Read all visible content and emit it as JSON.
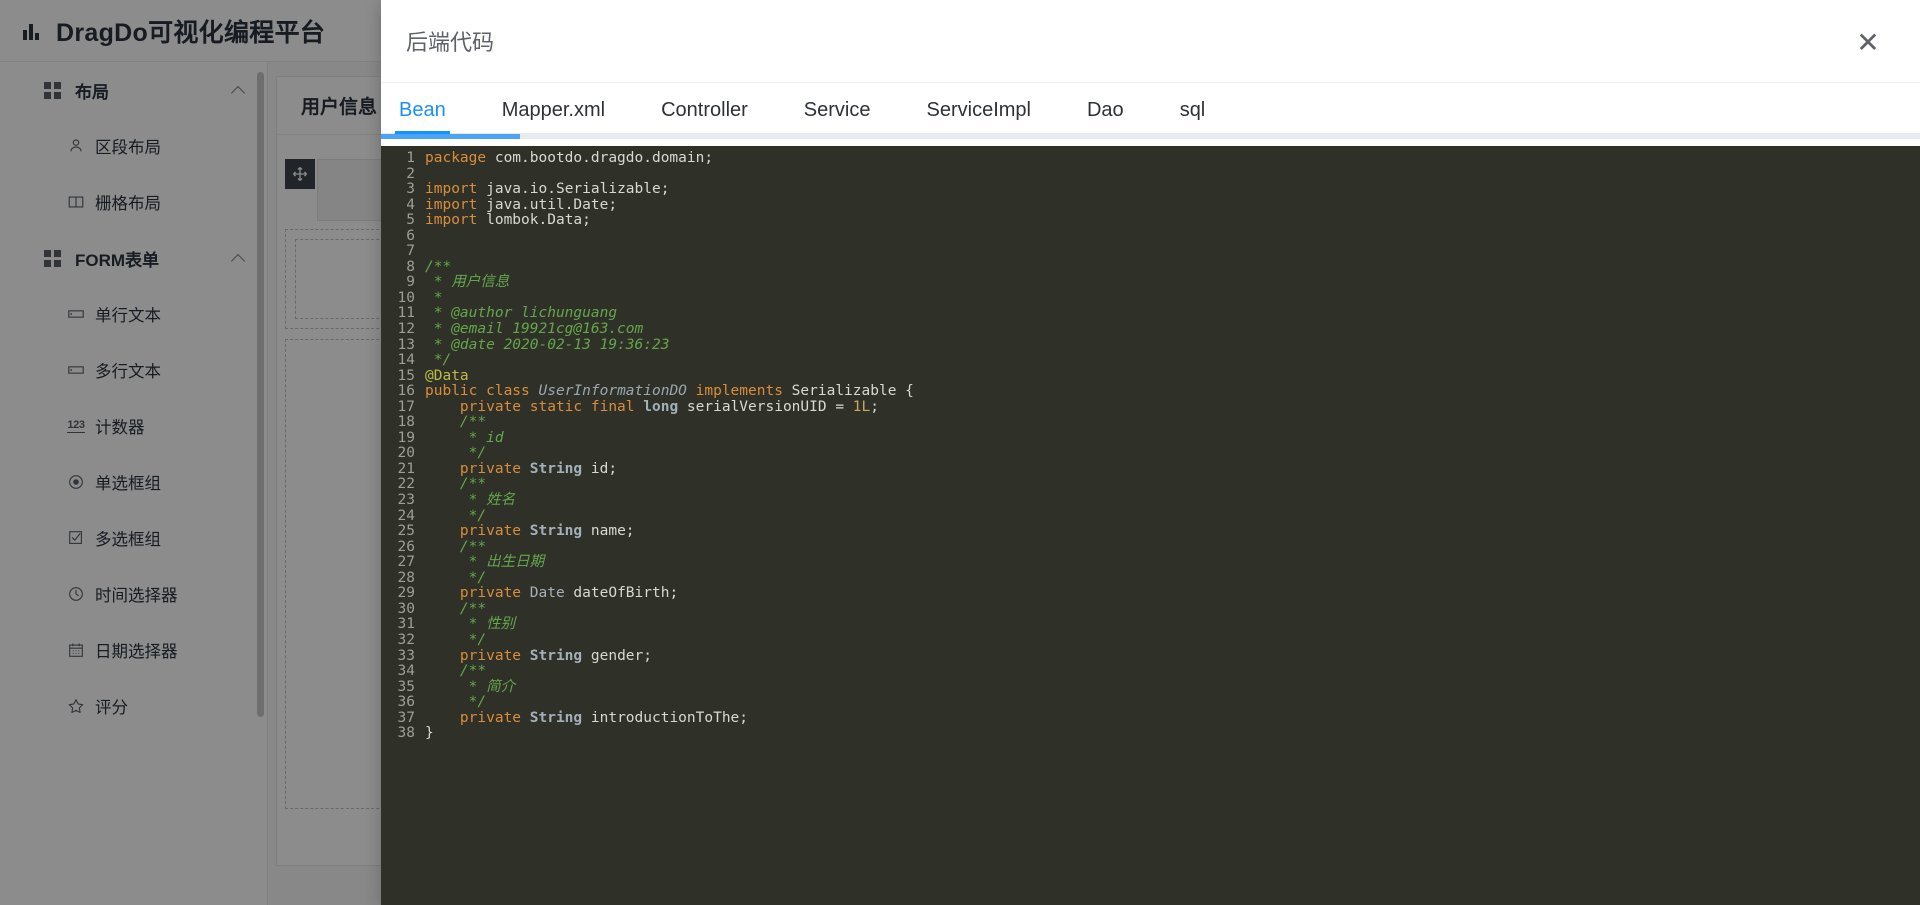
{
  "app": {
    "title": "DragDo可视化编程平台",
    "logo_icon": "bar-chart-icon"
  },
  "sidebar": {
    "groups": [
      {
        "label": "布局",
        "icon": "grid-icon",
        "chevron": "chevron-up-icon",
        "items": [
          {
            "label": "区段布局",
            "icon": "user-icon"
          },
          {
            "label": "栅格布局",
            "icon": "columns-icon"
          }
        ]
      },
      {
        "label": "FORM表单",
        "icon": "grid-icon",
        "chevron": "chevron-up-icon",
        "items": [
          {
            "label": "单行文本",
            "icon": "input-box-icon"
          },
          {
            "label": "多行文本",
            "icon": "textarea-icon"
          },
          {
            "label": "计数器",
            "icon": "number-123-icon"
          },
          {
            "label": "单选框组",
            "icon": "radio-icon"
          },
          {
            "label": "多选框组",
            "icon": "checkbox-icon"
          },
          {
            "label": "时间选择器",
            "icon": "clock-icon"
          },
          {
            "label": "日期选择器",
            "icon": "calendar-icon"
          },
          {
            "label": "评分",
            "icon": "star-icon"
          }
        ]
      }
    ]
  },
  "workspace": {
    "card_title": "用户信息",
    "move_icon": "move-arrows-icon"
  },
  "modal": {
    "title": "后端代码",
    "close_icon": "close-icon",
    "progress_percent": 9,
    "tabs": [
      {
        "label": "Bean",
        "active": true
      },
      {
        "label": "Mapper.xml",
        "active": false
      },
      {
        "label": "Controller",
        "active": false
      },
      {
        "label": "Service",
        "active": false
      },
      {
        "label": "ServiceImpl",
        "active": false
      },
      {
        "label": "Dao",
        "active": false
      },
      {
        "label": "sql",
        "active": false
      }
    ],
    "accent_color": "#1890ff",
    "code": {
      "language": "java",
      "background": "#2f3129",
      "lines": [
        {
          "n": 1,
          "tokens": [
            {
              "t": "package",
              "c": "k"
            },
            {
              "t": " com.bootdo.dragdo.domain;",
              "c": "pl"
            }
          ]
        },
        {
          "n": 2,
          "tokens": []
        },
        {
          "n": 3,
          "tokens": [
            {
              "t": "import",
              "c": "k"
            },
            {
              "t": " java.io.Serializable;",
              "c": "pl"
            }
          ]
        },
        {
          "n": 4,
          "tokens": [
            {
              "t": "import",
              "c": "k"
            },
            {
              "t": " java.util.Date;",
              "c": "pl"
            }
          ]
        },
        {
          "n": 5,
          "tokens": [
            {
              "t": "import",
              "c": "k"
            },
            {
              "t": " lombok.Data;",
              "c": "pl"
            }
          ]
        },
        {
          "n": 6,
          "tokens": []
        },
        {
          "n": 7,
          "tokens": []
        },
        {
          "n": 8,
          "tokens": [
            {
              "t": "/**",
              "c": "cm"
            }
          ]
        },
        {
          "n": 9,
          "tokens": [
            {
              "t": " * 用户信息",
              "c": "cm"
            }
          ]
        },
        {
          "n": 10,
          "tokens": [
            {
              "t": " *",
              "c": "cm"
            }
          ]
        },
        {
          "n": 11,
          "tokens": [
            {
              "t": " * @author lichunguang",
              "c": "cm"
            }
          ]
        },
        {
          "n": 12,
          "tokens": [
            {
              "t": " * @email 19921cg@163.com",
              "c": "cm"
            }
          ]
        },
        {
          "n": 13,
          "tokens": [
            {
              "t": " * @date 2020-02-13 19:36:23",
              "c": "cm"
            }
          ]
        },
        {
          "n": 14,
          "tokens": [
            {
              "t": " */",
              "c": "cm"
            }
          ]
        },
        {
          "n": 15,
          "tokens": [
            {
              "t": "@Data",
              "c": "ann"
            }
          ]
        },
        {
          "n": 16,
          "tokens": [
            {
              "t": "public class",
              "c": "k"
            },
            {
              "t": " ",
              "c": "pl"
            },
            {
              "t": "UserInformationDO",
              "c": "typ"
            },
            {
              "t": " ",
              "c": "pl"
            },
            {
              "t": "implements",
              "c": "k"
            },
            {
              "t": " Serializable {",
              "c": "pl"
            }
          ]
        },
        {
          "n": 17,
          "tokens": [
            {
              "t": "    ",
              "c": "pl"
            },
            {
              "t": "private static final",
              "c": "k"
            },
            {
              "t": " ",
              "c": "pl"
            },
            {
              "t": "long",
              "c": "tb"
            },
            {
              "t": " serialVersionUID = ",
              "c": "pl"
            },
            {
              "t": "1L",
              "c": "num"
            },
            {
              "t": ";",
              "c": "pl"
            }
          ]
        },
        {
          "n": 18,
          "tokens": [
            {
              "t": "    /**",
              "c": "cm"
            }
          ]
        },
        {
          "n": 19,
          "tokens": [
            {
              "t": "     * id",
              "c": "cm"
            }
          ]
        },
        {
          "n": 20,
          "tokens": [
            {
              "t": "     */",
              "c": "cm"
            }
          ]
        },
        {
          "n": 21,
          "tokens": [
            {
              "t": "    ",
              "c": "pl"
            },
            {
              "t": "private",
              "c": "k"
            },
            {
              "t": " ",
              "c": "pl"
            },
            {
              "t": "String",
              "c": "tb"
            },
            {
              "t": " id;",
              "c": "pl"
            }
          ]
        },
        {
          "n": 22,
          "tokens": [
            {
              "t": "    /**",
              "c": "cm"
            }
          ]
        },
        {
          "n": 23,
          "tokens": [
            {
              "t": "     * 姓名",
              "c": "cm"
            }
          ]
        },
        {
          "n": 24,
          "tokens": [
            {
              "t": "     */",
              "c": "cm"
            }
          ]
        },
        {
          "n": 25,
          "tokens": [
            {
              "t": "    ",
              "c": "pl"
            },
            {
              "t": "private",
              "c": "k"
            },
            {
              "t": " ",
              "c": "pl"
            },
            {
              "t": "String",
              "c": "tb"
            },
            {
              "t": " name;",
              "c": "pl"
            }
          ]
        },
        {
          "n": 26,
          "tokens": [
            {
              "t": "    /**",
              "c": "cm"
            }
          ]
        },
        {
          "n": 27,
          "tokens": [
            {
              "t": "     * 出生日期",
              "c": "cm"
            }
          ]
        },
        {
          "n": 28,
          "tokens": [
            {
              "t": "     */",
              "c": "cm"
            }
          ]
        },
        {
          "n": 29,
          "tokens": [
            {
              "t": "    ",
              "c": "pl"
            },
            {
              "t": "private",
              "c": "k"
            },
            {
              "t": " ",
              "c": "pl"
            },
            {
              "t": "Date",
              "c": "tn"
            },
            {
              "t": " dateOfBirth;",
              "c": "pl"
            }
          ]
        },
        {
          "n": 30,
          "tokens": [
            {
              "t": "    /**",
              "c": "cm"
            }
          ]
        },
        {
          "n": 31,
          "tokens": [
            {
              "t": "     * 性别",
              "c": "cm"
            }
          ]
        },
        {
          "n": 32,
          "tokens": [
            {
              "t": "     */",
              "c": "cm"
            }
          ]
        },
        {
          "n": 33,
          "tokens": [
            {
              "t": "    ",
              "c": "pl"
            },
            {
              "t": "private",
              "c": "k"
            },
            {
              "t": " ",
              "c": "pl"
            },
            {
              "t": "String",
              "c": "tb"
            },
            {
              "t": " gender;",
              "c": "pl"
            }
          ]
        },
        {
          "n": 34,
          "tokens": [
            {
              "t": "    /**",
              "c": "cm"
            }
          ]
        },
        {
          "n": 35,
          "tokens": [
            {
              "t": "     * 简介",
              "c": "cm"
            }
          ]
        },
        {
          "n": 36,
          "tokens": [
            {
              "t": "     */",
              "c": "cm"
            }
          ]
        },
        {
          "n": 37,
          "tokens": [
            {
              "t": "    ",
              "c": "pl"
            },
            {
              "t": "private",
              "c": "k"
            },
            {
              "t": " ",
              "c": "pl"
            },
            {
              "t": "String",
              "c": "tb"
            },
            {
              "t": " introductionToThe;",
              "c": "pl"
            }
          ]
        },
        {
          "n": 38,
          "tokens": [
            {
              "t": "}",
              "c": "pl"
            }
          ]
        }
      ]
    }
  }
}
